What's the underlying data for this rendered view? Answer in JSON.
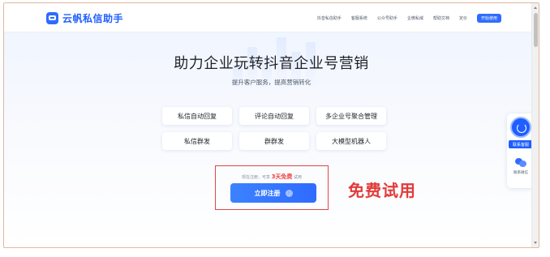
{
  "brand": {
    "name": "云帆私信助手",
    "accent": "#2f6bff"
  },
  "nav": {
    "items": [
      "抖音私信助手",
      "客服系统",
      "公众号助手",
      "企微私域",
      "帮助文档",
      "定价"
    ],
    "cta": "开始使用"
  },
  "hero": {
    "title": "助力企业玩转抖音企业号营销",
    "subtitle": "提升客户服务，提高营销转化"
  },
  "features": [
    "私信自动回复",
    "评论自动回复",
    "多企业号聚合管理",
    "私信群发",
    "群群发",
    "大模型机器人"
  ],
  "trial": {
    "note_prefix": "现在注册，可享",
    "note_highlight": "3天免费",
    "note_suffix": "试用",
    "button_label": "立即注册",
    "annotation": "免费试用",
    "highlight_color": "#e23b3b"
  },
  "widget": {
    "contact_label": "联系客服",
    "wechat_label": "联系微信"
  }
}
